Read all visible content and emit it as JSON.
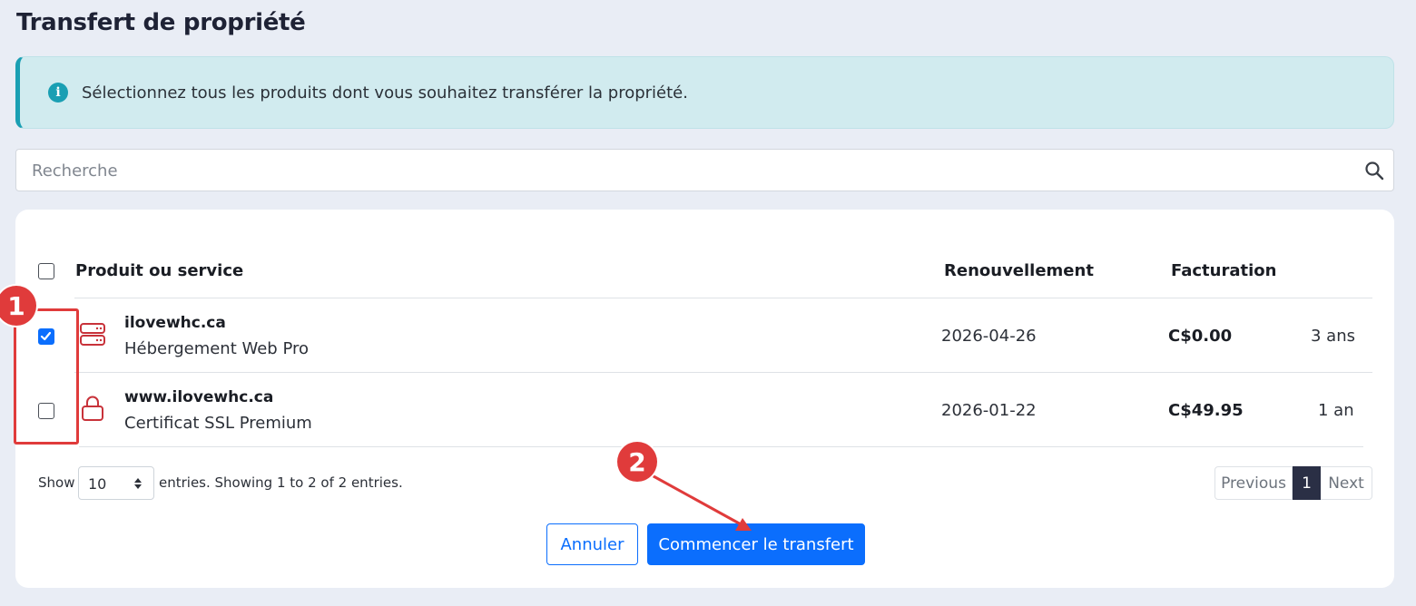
{
  "page": {
    "title": "Transfert de propriété"
  },
  "alert": {
    "text": "Sélectionnez tous les produits dont vous souhaitez transférer la propriété."
  },
  "search": {
    "placeholder": "Recherche"
  },
  "table": {
    "headers": {
      "product": "Produit ou service",
      "renewal": "Renouvellement",
      "billing": "Facturation"
    },
    "rows": [
      {
        "name": "ilovewhc.ca",
        "subtitle": "Hébergement Web Pro",
        "renewal": "2026-04-26",
        "price": "C$0.00",
        "term": "3 ans",
        "checked": true,
        "icon": "server-icon"
      },
      {
        "name": "www.ilovewhc.ca",
        "subtitle": "Certificat SSL Premium",
        "renewal": "2026-01-22",
        "price": "C$49.95",
        "term": "1 an",
        "checked": false,
        "icon": "lock-icon"
      }
    ]
  },
  "footer": {
    "show_label": "Show",
    "entries_value": "10",
    "entries_text": "entries. Showing 1 to 2 of 2 entries.",
    "pagination": {
      "previous": "Previous",
      "current": "1",
      "next": "Next"
    }
  },
  "actions": {
    "cancel": "Annuler",
    "start": "Commencer le transfert"
  },
  "annotations": {
    "badge1": "1",
    "badge2": "2"
  },
  "colors": {
    "accent": "#0b6efd",
    "info": "#1a9fb3",
    "annotation": "#e03b3b",
    "icon": "#c8323a"
  }
}
